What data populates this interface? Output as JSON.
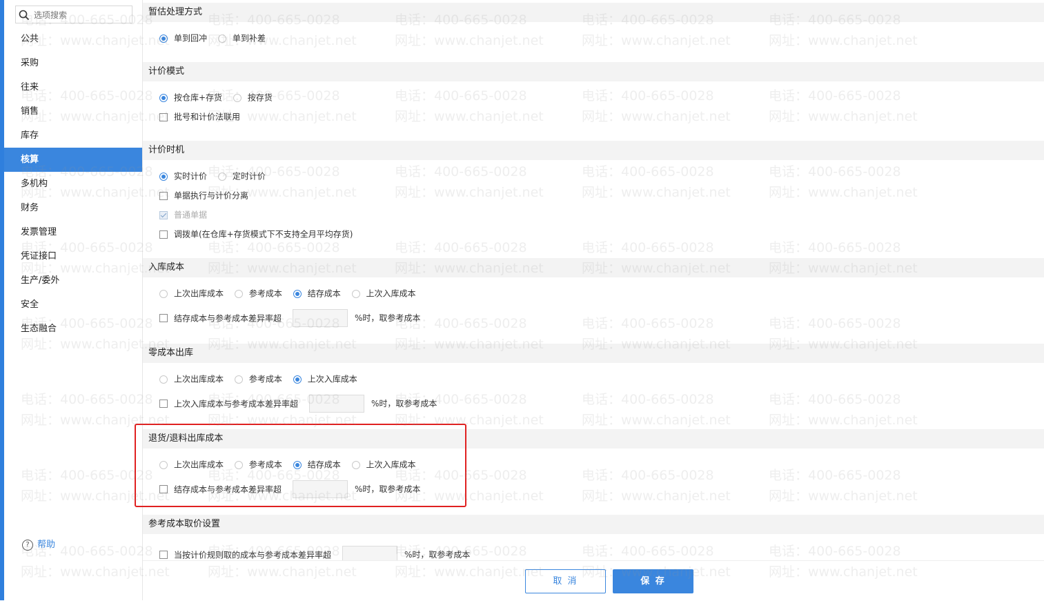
{
  "search": {
    "placeholder": "选项搜索",
    "icon": "search-icon"
  },
  "sidebar": {
    "items": [
      {
        "label": "公共"
      },
      {
        "label": "采购"
      },
      {
        "label": "往来"
      },
      {
        "label": "销售"
      },
      {
        "label": "库存"
      },
      {
        "label": "核算",
        "active": true
      },
      {
        "label": "多机构"
      },
      {
        "label": "财务"
      },
      {
        "label": "发票管理"
      },
      {
        "label": "凭证接口"
      },
      {
        "label": "生产/委外"
      },
      {
        "label": "安全"
      },
      {
        "label": "生态融合"
      }
    ],
    "help_label": "帮助",
    "active_color": "#3a86de"
  },
  "sections": {
    "estimate": {
      "title": "暂估处理方式",
      "options": [
        {
          "label": "单到回冲",
          "checked": true
        },
        {
          "label": "单到补差",
          "checked": false
        }
      ]
    },
    "pricing_mode": {
      "title": "计价模式",
      "options": [
        {
          "label": "按仓库+存货",
          "checked": true
        },
        {
          "label": "按存货",
          "checked": false
        }
      ],
      "batch_label": "批号和计价法联用"
    },
    "pricing_time": {
      "title": "计价时机",
      "options": [
        {
          "label": "实时计价",
          "checked": true
        },
        {
          "label": "定时计价",
          "checked": false
        }
      ],
      "separate_label": "单据执行与计价分离",
      "normal_label": "普通单据",
      "transfer_label": "调拨单(在仓库+存货模式下不支持全月平均存货)"
    },
    "inbound_cost": {
      "title": "入库成本",
      "options": [
        {
          "label": "上次出库成本",
          "checked": false
        },
        {
          "label": "参考成本",
          "checked": false
        },
        {
          "label": "结存成本",
          "checked": true
        },
        {
          "label": "上次入库成本",
          "checked": false
        }
      ],
      "diff_label": "结存成本与参考成本差异率超",
      "suffix": "%时，取参考成本"
    },
    "zero_cost": {
      "title": "零成本出库",
      "options": [
        {
          "label": "上次出库成本",
          "checked": false
        },
        {
          "label": "参考成本",
          "checked": false
        },
        {
          "label": "上次入库成本",
          "checked": true
        }
      ],
      "diff_label": "上次入库成本与参考成本差异率超",
      "suffix": "%时，取参考成本"
    },
    "return_cost": {
      "title": "退货/退料出库成本",
      "options": [
        {
          "label": "上次出库成本",
          "checked": false
        },
        {
          "label": "参考成本",
          "checked": false
        },
        {
          "label": "结存成本",
          "checked": true
        },
        {
          "label": "上次入库成本",
          "checked": false
        }
      ],
      "diff_label": "结存成本与参考成本差异率超",
      "suffix": "%时，取参考成本"
    },
    "reference": {
      "title": "参考成本取价设置",
      "diff_label": "当按计价规则取的成本与参考成本差异率超",
      "suffix": "%时，取参考成本"
    }
  },
  "footer": {
    "cancel_label": "取 消",
    "save_label": "保 存"
  },
  "watermark": {
    "phone": "电话：400-665-0028",
    "site": "网址：www.chanjet.net"
  },
  "highlight_color": "#e02020"
}
